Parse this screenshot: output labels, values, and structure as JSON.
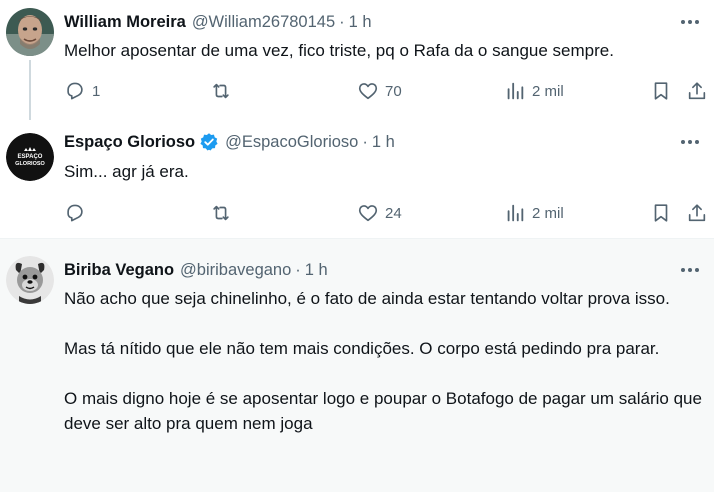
{
  "tweets": [
    {
      "name": "William Moreira",
      "handle": "@William26780145",
      "time": "1 h",
      "paragraphs": [
        "Melhor aposentar de uma vez, fico triste, pq o Rafa da o sangue sempre."
      ],
      "replies": "1",
      "retweets": "",
      "likes": "70",
      "views": "2 mil",
      "avatar_icon": "person-photo-avatar"
    },
    {
      "name": "Espaço Glorioso",
      "handle": "@EspacoGlorioso",
      "time": "1 h",
      "verified": true,
      "paragraphs": [
        "Sim... agr já era."
      ],
      "replies": "",
      "retweets": "",
      "likes": "24",
      "views": "2 mil",
      "avatar_icon": "espaco-glorioso-logo",
      "avatar_text": [
        "ESPAÇO",
        "GLORIOSO"
      ]
    },
    {
      "name": "Biriba Vegano",
      "handle": "@biribavegano",
      "time": "1 h",
      "paragraphs": [
        "Não acho que seja chinelinho, é o fato de ainda estar tentando voltar prova isso.",
        "Mas tá nítido que ele não tem mais condições. O corpo está pedindo pra parar.",
        "O mais digno hoje é se aposentar logo e poupar o Botafogo de pagar um salário que deve ser alto pra quem nem joga"
      ],
      "avatar_icon": "cartoon-dog-avatar"
    }
  ],
  "separator": "·",
  "colors": {
    "text": "#0f1419",
    "muted": "#536471",
    "verified": "#1d9bf0",
    "highlight_bg": "#f7f9f9"
  }
}
